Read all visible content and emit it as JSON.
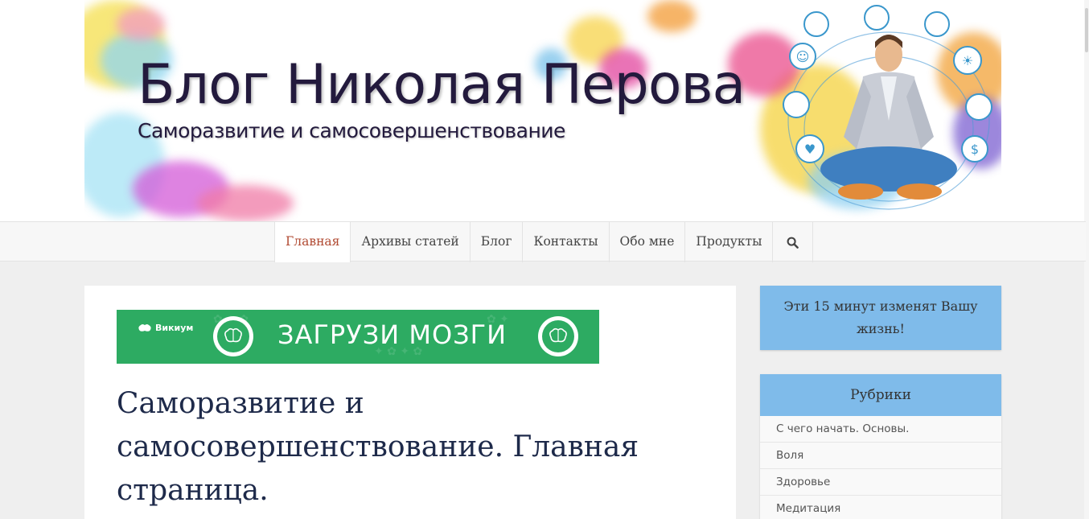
{
  "header": {
    "site_title": "Блог Николая Перова",
    "tagline": "Саморазвитие и самосовершенствование"
  },
  "nav": {
    "items": [
      {
        "label": "Главная",
        "active": true
      },
      {
        "label": "Архивы статей",
        "active": false
      },
      {
        "label": "Блог",
        "active": false
      },
      {
        "label": "Контакты",
        "active": false
      },
      {
        "label": "Обо мне",
        "active": false
      },
      {
        "label": "Продукты",
        "active": false
      }
    ],
    "search_icon": "search-icon"
  },
  "ad": {
    "brand": "Викиум",
    "text": "ЗАГРУЗИ МОЗГИ"
  },
  "main": {
    "title": "Саморазвитие и самосовершенствование. Главная страница."
  },
  "sidebar": {
    "cta_text": "Эти 15 минут изменят Вашу жизнь!",
    "categories_title": "Рубрики",
    "categories": [
      "С чего начать. Основы.",
      "Воля",
      "Здоровье",
      "Медитация"
    ]
  },
  "colors": {
    "accent_nav_active": "#b14b33",
    "widget_blue": "#7fbbea",
    "ad_green": "#2dab62",
    "title_dark": "#231a3d"
  }
}
